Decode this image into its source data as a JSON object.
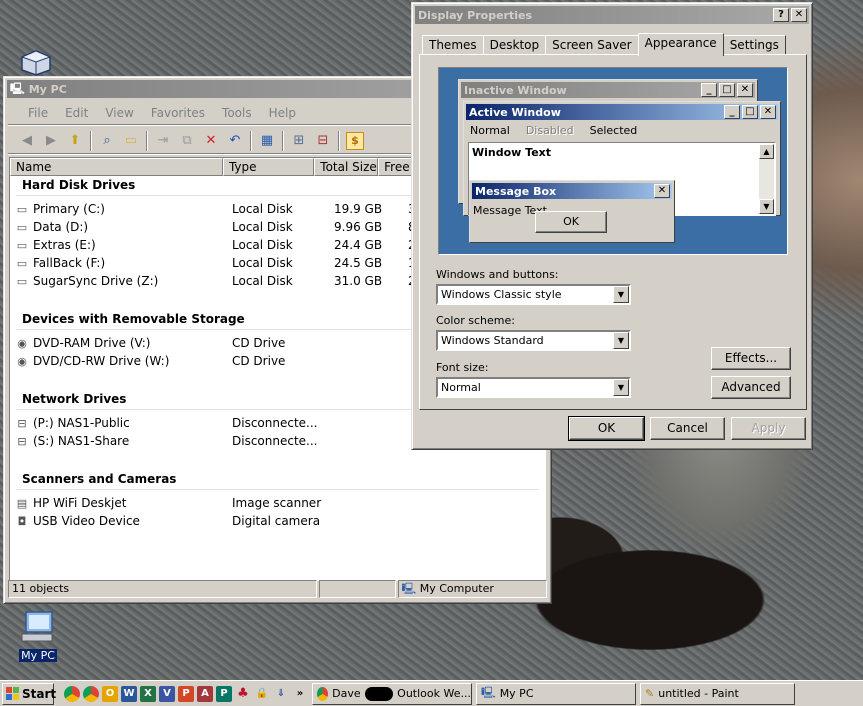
{
  "desktop": {
    "icon_label": "My PC"
  },
  "mypc": {
    "title": "My PC",
    "menu": [
      "File",
      "Edit",
      "View",
      "Favorites",
      "Tools",
      "Help"
    ],
    "columns": [
      "Name",
      "Type",
      "Total Size",
      "Free"
    ],
    "groups": [
      {
        "title": "Hard Disk Drives",
        "items": [
          {
            "name": "Primary (C:)",
            "type": "Local Disk",
            "size": "19.9 GB",
            "free": "3"
          },
          {
            "name": "Data (D:)",
            "type": "Local Disk",
            "size": "9.96 GB",
            "free": "8"
          },
          {
            "name": "Extras (E:)",
            "type": "Local Disk",
            "size": "24.4 GB",
            "free": "2"
          },
          {
            "name": "FallBack (F:)",
            "type": "Local Disk",
            "size": "24.5 GB",
            "free": "1"
          },
          {
            "name": "SugarSync Drive (Z:)",
            "type": "Local Disk",
            "size": "31.0 GB",
            "free": "2"
          }
        ]
      },
      {
        "title": "Devices with Removable Storage",
        "items": [
          {
            "name": "DVD-RAM Drive (V:)",
            "type": "CD Drive",
            "size": "",
            "free": ""
          },
          {
            "name": "DVD/CD-RW Drive (W:)",
            "type": "CD Drive",
            "size": "",
            "free": ""
          }
        ]
      },
      {
        "title": "Network Drives",
        "items": [
          {
            "name": "(P:) NAS1-Public",
            "type": "Disconnecte...",
            "size": "",
            "free": ""
          },
          {
            "name": "(S:) NAS1-Share",
            "type": "Disconnecte...",
            "size": "",
            "free": ""
          }
        ]
      },
      {
        "title": "Scanners and Cameras",
        "items": [
          {
            "name": "HP WiFi Deskjet",
            "type": "Image scanner",
            "size": "",
            "free": ""
          },
          {
            "name": "USB Video Device",
            "type": "Digital camera",
            "size": "",
            "free": ""
          }
        ]
      }
    ],
    "status": {
      "count": "11 objects",
      "location": "My Computer"
    }
  },
  "display": {
    "title": "Display Properties",
    "tabs": [
      "Themes",
      "Desktop",
      "Screen Saver",
      "Appearance",
      "Settings"
    ],
    "preview": {
      "inactive_title": "Inactive Window",
      "active_title": "Active Window",
      "menu_normal": "Normal",
      "menu_disabled": "Disabled",
      "menu_selected": "Selected",
      "window_text": "Window Text",
      "msgbox_title": "Message Box",
      "msgbox_text": "Message Text",
      "msgbox_ok": "OK"
    },
    "windows_buttons_label": "Windows and buttons:",
    "windows_buttons_value": "Windows Classic style",
    "color_scheme_label": "Color scheme:",
    "color_scheme_value": "Windows Standard",
    "font_size_label": "Font size:",
    "font_size_value": "Normal",
    "effects_btn": "Effects...",
    "advanced_btn": "Advanced",
    "ok_btn": "OK",
    "cancel_btn": "Cancel",
    "apply_btn": "Apply"
  },
  "taskbar": {
    "start": "Start",
    "quicklaunch": [
      "C",
      "O",
      "W",
      "X",
      "V",
      "P",
      "A",
      "P"
    ],
    "tasks": [
      {
        "label": "Dave",
        "label2": "Outlook We..."
      },
      {
        "label": "My PC"
      },
      {
        "label": "untitled - Paint"
      }
    ]
  },
  "colors": {
    "active_title": "#0a246a",
    "face": "#d4d0c8",
    "desktop_preview": "#3a6ea5"
  }
}
